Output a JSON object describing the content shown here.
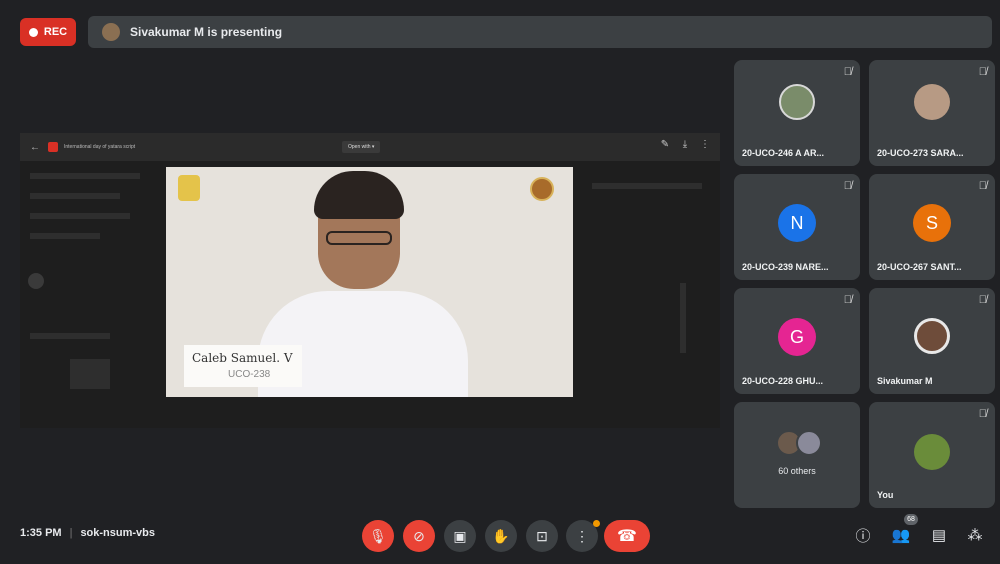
{
  "recording": {
    "label": "REC"
  },
  "presenting_banner": "Sivakumar M is presenting",
  "shared_screen": {
    "file_name": "International day of yatara script",
    "open_with_label": "Open with ▾",
    "video": {
      "name_line1": "Caleb Samuel. V",
      "name_line2": "UCO-238"
    }
  },
  "participants": [
    {
      "name": "20-UCO-246 A AR...",
      "avatar": "photo",
      "muted": true
    },
    {
      "name": "20-UCO-273 SARA...",
      "avatar": "photo",
      "muted": true
    },
    {
      "name": "20-UCO-239 NARE...",
      "avatar": "letter",
      "letter": "N",
      "color": "#1a73e8",
      "muted": true
    },
    {
      "name": "20-UCO-267 SANT...",
      "avatar": "letter",
      "letter": "S",
      "color": "#e8710a",
      "muted": true
    },
    {
      "name": "20-UCO-228 GHU...",
      "avatar": "letter",
      "letter": "G",
      "color": "#e52592",
      "muted": true
    },
    {
      "name": "Sivakumar M",
      "avatar": "photo",
      "muted": true
    },
    {
      "name": "60 others",
      "avatar": "group"
    },
    {
      "name": "You",
      "avatar": "photo",
      "muted": true
    }
  ],
  "meeting": {
    "time": "1:35 PM",
    "separator": "|",
    "code": "sok-nsum-vbs"
  },
  "controls": {
    "mic": "microphone-off",
    "camera": "camera-off",
    "captions": "captions",
    "hand": "raise-hand",
    "present": "present-screen",
    "more": "more-options",
    "end": "end-call"
  },
  "right_controls": {
    "people_count": "68"
  },
  "colors": {
    "background": "#202124",
    "tile": "#3c4043",
    "danger": "#ea4335",
    "accent_orange": "#f29900"
  }
}
